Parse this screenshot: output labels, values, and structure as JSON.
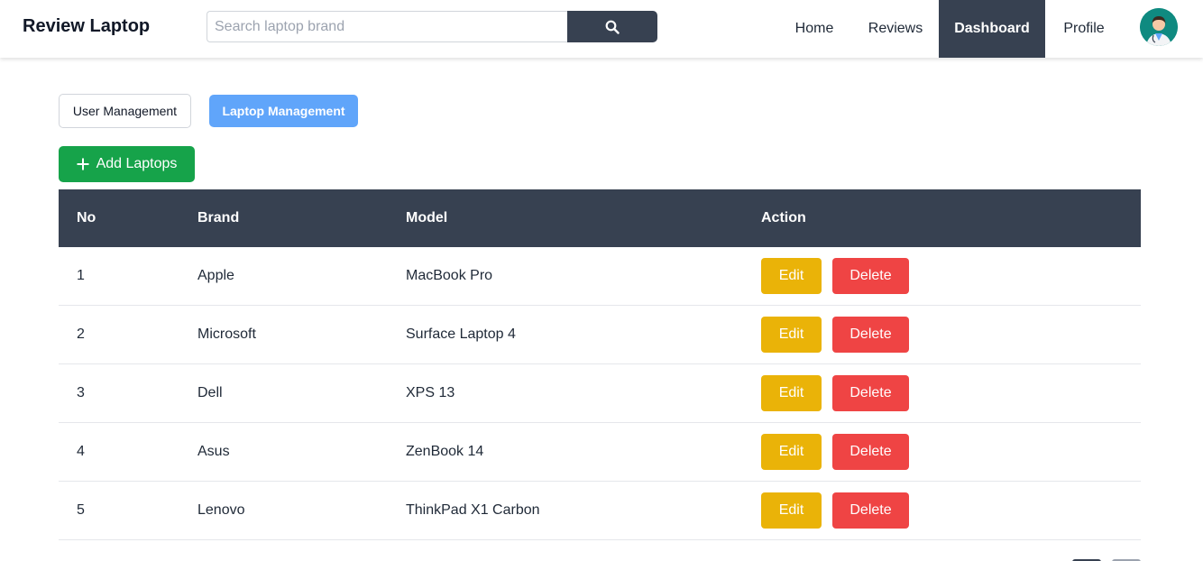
{
  "header": {
    "brand": "Review Laptop",
    "search": {
      "placeholder": "Search laptop brand",
      "value": ""
    },
    "nav": [
      "Home",
      "Reviews",
      "Dashboard",
      "Profile"
    ],
    "active_nav": "Dashboard"
  },
  "tabs": {
    "user_management": "User Management",
    "laptop_management": "Laptop Management",
    "active": "Laptop Management"
  },
  "add_button": {
    "label": "Add Laptops",
    "icon": "plus-icon"
  },
  "table": {
    "columns": [
      "No",
      "Brand",
      "Model",
      "Action"
    ],
    "rows": [
      {
        "no": "1",
        "brand": "Apple",
        "model": "MacBook Pro"
      },
      {
        "no": "2",
        "brand": "Microsoft",
        "model": "Surface Laptop 4"
      },
      {
        "no": "3",
        "brand": "Dell",
        "model": "XPS 13"
      },
      {
        "no": "4",
        "brand": "Asus",
        "model": "ZenBook 14"
      },
      {
        "no": "5",
        "brand": "Lenovo",
        "model": "ThinkPad X1 Carbon"
      }
    ],
    "edit_label": "Edit",
    "delete_label": "Delete"
  },
  "colors": {
    "dark": "#374151",
    "active_tab": "#60a5fa",
    "add": "#16a34a",
    "edit": "#eab308",
    "delete": "#ef4444"
  }
}
